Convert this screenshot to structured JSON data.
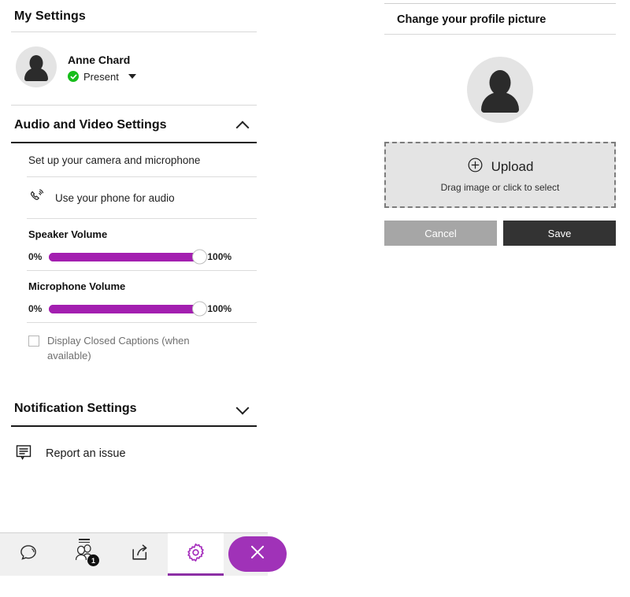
{
  "settings_panel": {
    "title": "My Settings",
    "user": {
      "name": "Anne Chard",
      "presence_status": "Present",
      "avatar_icon": "person-avatar-icon",
      "presence_icon": "check-circle-icon",
      "dropdown_icon": "caret-down-icon"
    },
    "audio_video": {
      "title": "Audio and Video Settings",
      "expanded": true,
      "collapse_icon": "chevron-up-icon",
      "camera_setup_label": "Set up your camera and microphone",
      "phone_audio_label": "Use your phone for audio",
      "phone_audio_icon": "phone-ringing-icon",
      "speaker": {
        "label": "Speaker Volume",
        "min_label": "0%",
        "max_label": "100%",
        "value": 100
      },
      "microphone": {
        "label": "Microphone Volume",
        "min_label": "0%",
        "max_label": "100%",
        "value": 100
      },
      "closed_captions": {
        "label": "Display Closed Captions (when available)",
        "checked": false
      }
    },
    "notifications": {
      "title": "Notification Settings",
      "expanded": false,
      "expand_icon": "chevron-down-icon"
    },
    "report_issue": {
      "label": "Report an issue",
      "icon": "feedback-bubble-icon"
    }
  },
  "profile_picture_panel": {
    "title": "Change your profile picture",
    "avatar_icon": "person-avatar-icon",
    "upload": {
      "label": "Upload",
      "icon": "plus-circle-icon",
      "hint": "Drag image or click to select"
    },
    "cancel_label": "Cancel",
    "save_label": "Save"
  },
  "toolbar": {
    "items": [
      {
        "name": "chat",
        "icon": "chat-bubble-icon",
        "active": false
      },
      {
        "name": "participants",
        "icon": "participants-icon",
        "active": false,
        "badge": "1"
      },
      {
        "name": "share",
        "icon": "share-icon",
        "active": false
      },
      {
        "name": "settings",
        "icon": "gear-icon",
        "active": true
      }
    ],
    "close_label": "",
    "close_icon": "close-x-icon"
  },
  "colors": {
    "accent_purple": "#a31fb0",
    "toolbar_active": "#8c2fa5",
    "close_button": "#a032b8",
    "presence_green": "#17bd1b",
    "save_button": "#333333",
    "cancel_button": "#a6a6a6"
  }
}
